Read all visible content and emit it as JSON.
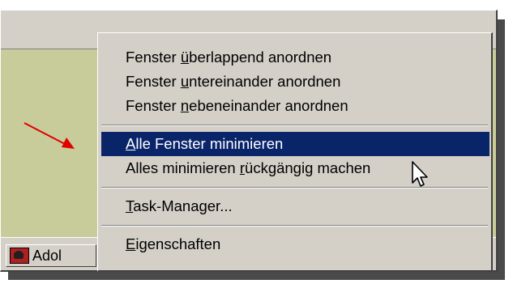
{
  "taskbar": {
    "button_label": "Adol"
  },
  "menu": {
    "items": [
      {
        "before": "Fenster ",
        "accel": "ü",
        "after": "berlappend anordnen"
      },
      {
        "before": "Fenster ",
        "accel": "u",
        "after": "ntereinander anordnen"
      },
      {
        "before": "Fenster ",
        "accel": "n",
        "after": "ebeneinander anordnen"
      },
      {
        "before": "",
        "accel": "A",
        "after": "lle Fenster minimieren"
      },
      {
        "before": "Alles minimieren ",
        "accel": "r",
        "after": "ückgängig machen"
      },
      {
        "before": "",
        "accel": "T",
        "after": "ask-Manager..."
      },
      {
        "before": "",
        "accel": "E",
        "after": "igenschaften"
      }
    ]
  },
  "colors": {
    "selection": "#0a246a",
    "desktop": "#c7cc9a",
    "arrow": "#e00000",
    "face": "#d4d0c8"
  },
  "icons": [
    "app-icon",
    "mouse-pointer-icon",
    "annotation-arrow"
  ]
}
